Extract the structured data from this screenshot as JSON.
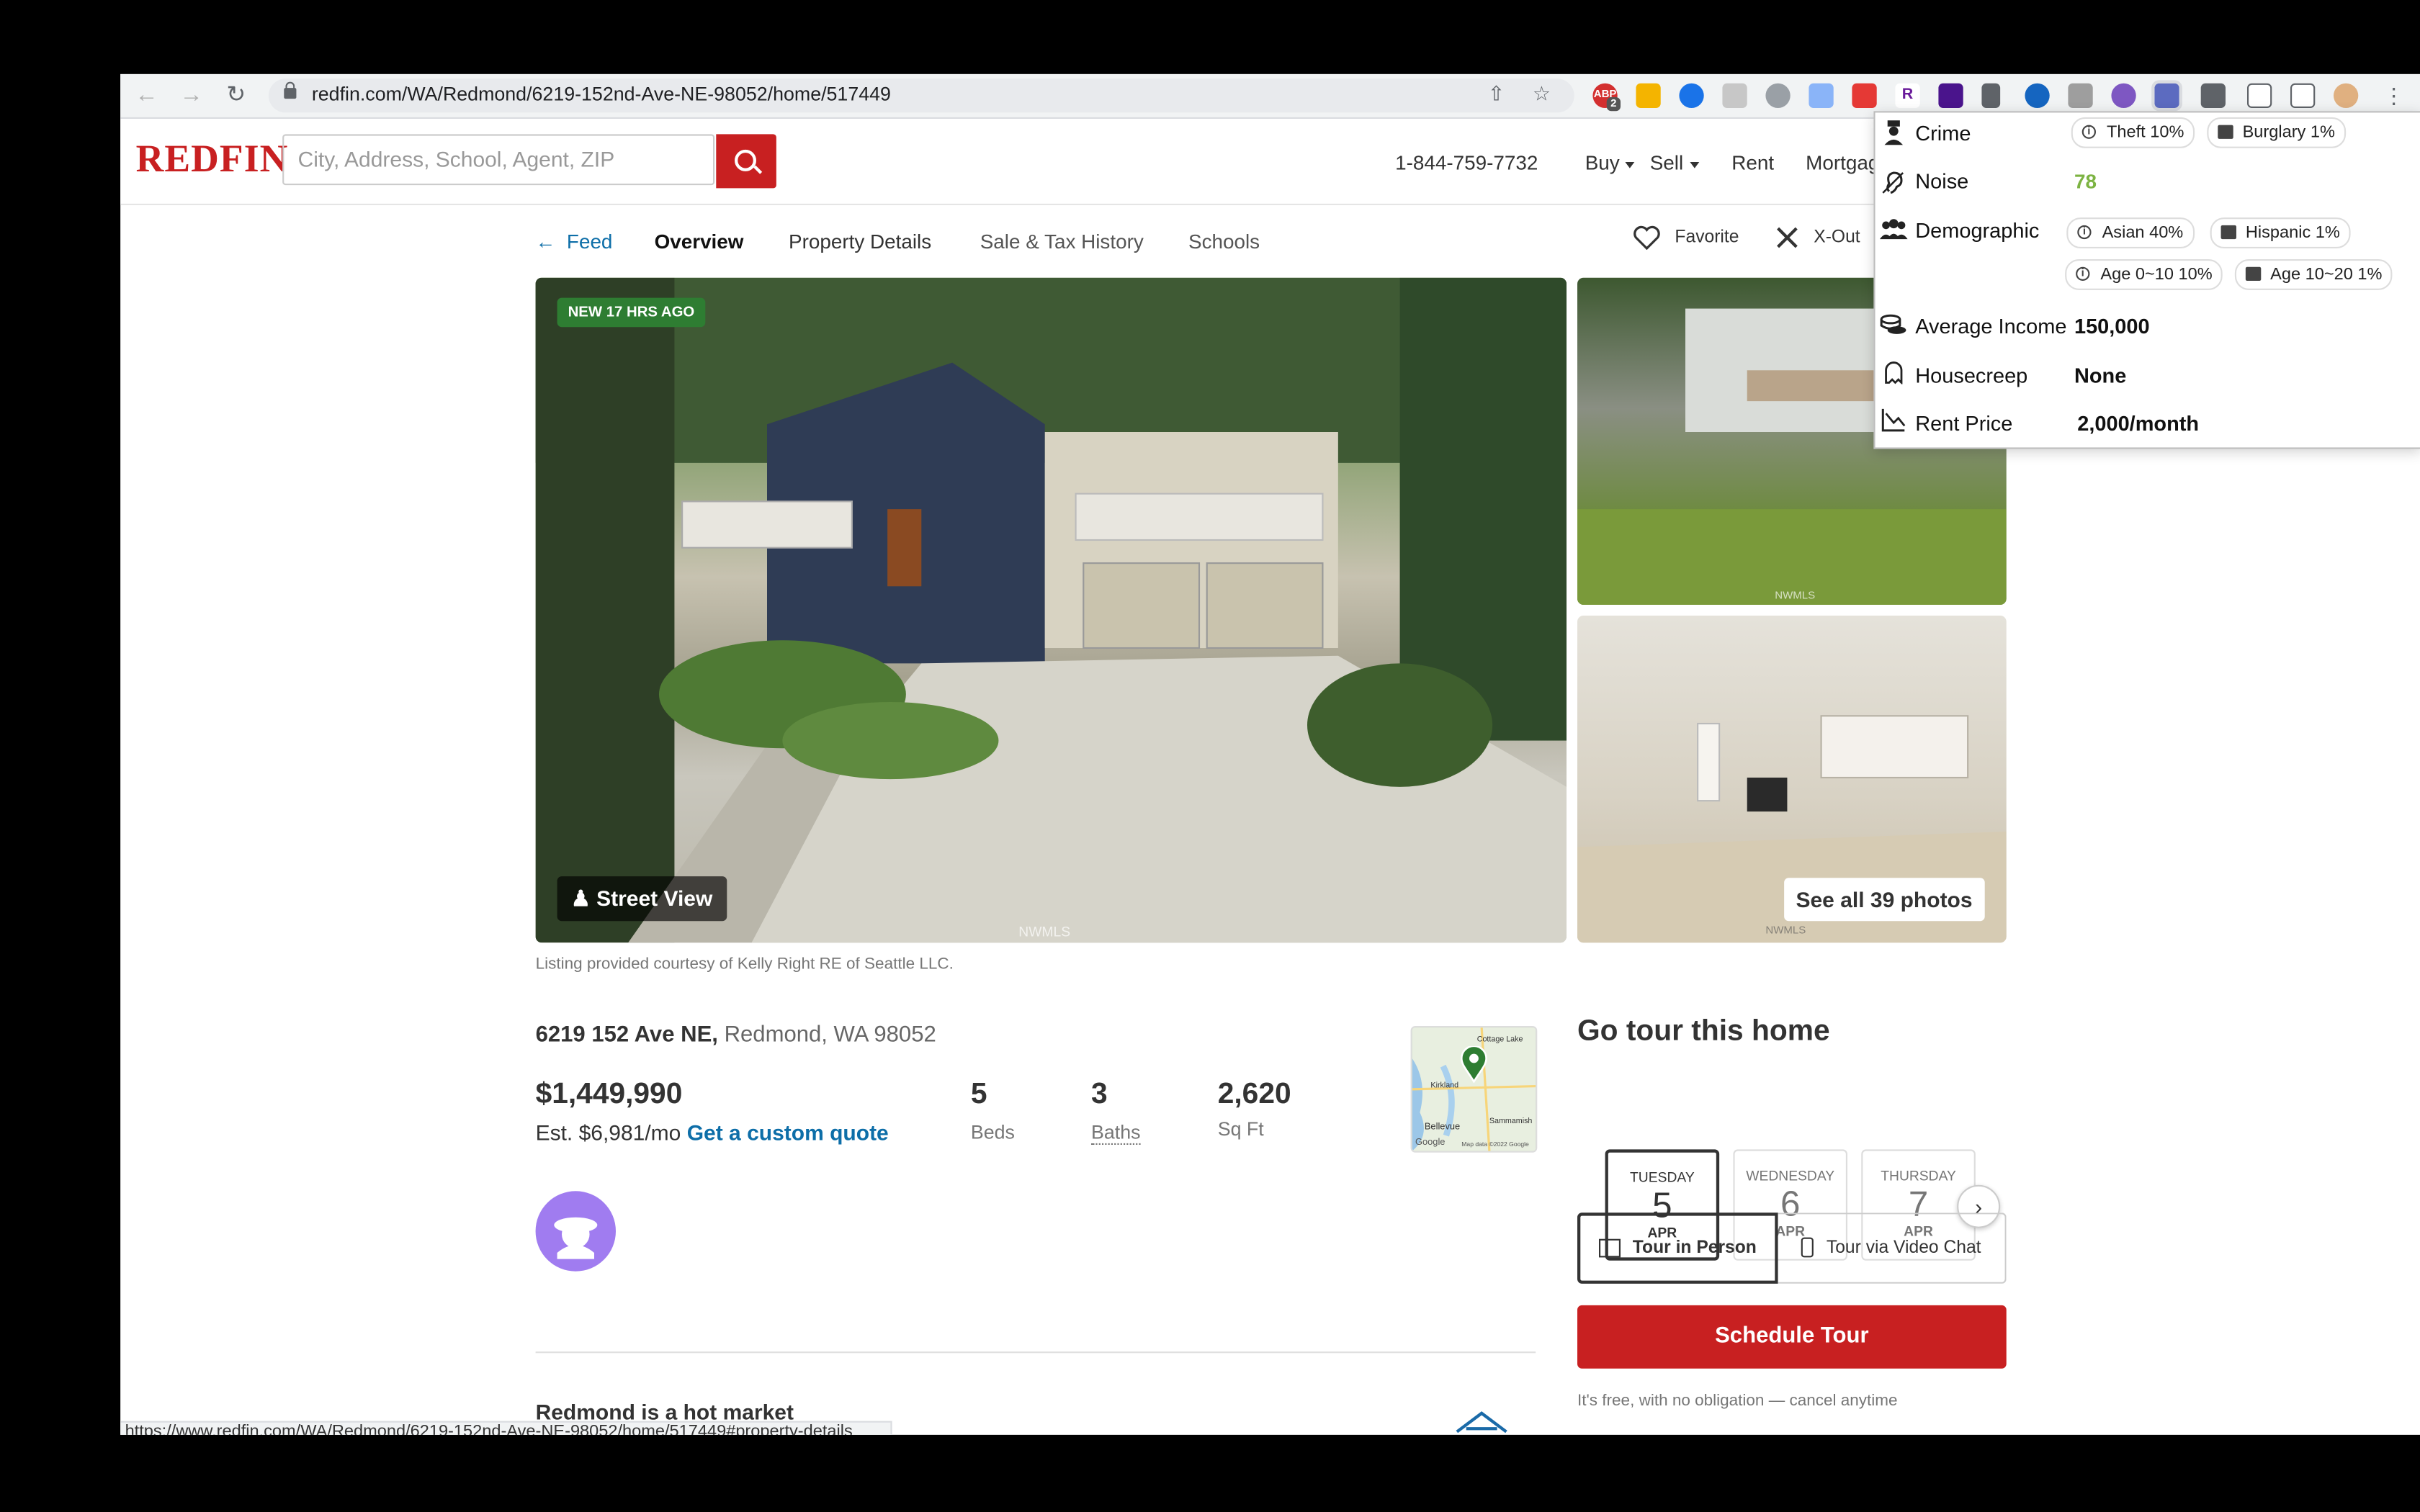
{
  "browser": {
    "url": "redfin.com/WA/Redmond/6219-152nd-Ave-NE-98052/home/517449",
    "abp_count": "2",
    "status_url": "https://www.redfin.com/WA/Redmond/6219-152nd-Ave-NE-98052/home/517449#property-details"
  },
  "header": {
    "logo": "REDFIN",
    "search_placeholder": "City, Address, School, Agent, ZIP",
    "phone": "1-844-759-7732",
    "nav": [
      "Buy",
      "Sell",
      "Rent",
      "Mortgage"
    ]
  },
  "subnav": {
    "back": "Feed",
    "tabs": [
      "Overview",
      "Property Details",
      "Sale & Tax History",
      "Schools"
    ],
    "favorite": "Favorite",
    "xout": "X-Out"
  },
  "photos": {
    "badge": "NEW 17 HRS AGO",
    "street_view": "Street View",
    "see_all": "See all 39 photos",
    "watermark": "NWMLS",
    "credit": "Listing provided courtesy of Kelly Right RE of Seattle LLC."
  },
  "listing": {
    "street": "6219 152 Ave NE,",
    "city": "Redmond, WA 98052",
    "price": "$1,449,990",
    "est_prefix": "Est. $6,981/mo",
    "quote_link": "Get a custom quote",
    "beds": "5",
    "beds_label": "Beds",
    "baths": "3",
    "baths_label": "Baths",
    "sqft": "2,620",
    "sqft_label": "Sq Ft",
    "map_labels": [
      "Cottage Lake",
      "Kirkland",
      "Bellevue",
      "Sammamish",
      "Map data ©2022 Google",
      "Google"
    ],
    "hot_market": "Redmond is a hot market"
  },
  "tour": {
    "title": "Go tour this home",
    "days": [
      {
        "dow": "TUESDAY",
        "day": "5",
        "mon": "APR"
      },
      {
        "dow": "WEDNESDAY",
        "day": "6",
        "mon": "APR"
      },
      {
        "dow": "THURSDAY",
        "day": "7",
        "mon": "APR"
      }
    ],
    "in_person": "Tour in Person",
    "video": "Tour via Video Chat",
    "schedule": "Schedule Tour",
    "note": "It's free, with no obligation — cancel anytime"
  },
  "popup": {
    "crime_label": "Crime",
    "crime_chips": [
      "Theft 10%",
      "Burglary 1%"
    ],
    "noise_label": "Noise",
    "noise_value": "78",
    "noise_color": "#7cb342",
    "demo_label": "Demographic",
    "demo_chips": [
      "Asian 40%",
      "Hispanic 1%",
      "Age 0~10 10%",
      "Age 10~20 1%"
    ],
    "income_label": "Average Income",
    "income_value": "150,000",
    "creep_label": "Housecreep",
    "creep_value": "None",
    "rent_label": "Rent Price",
    "rent_value": "2,000/month"
  },
  "colors": {
    "brand": "#c82021",
    "link": "#0d6ea8",
    "green_badge": "#2e7d32",
    "avatar": "#a07cf0"
  }
}
